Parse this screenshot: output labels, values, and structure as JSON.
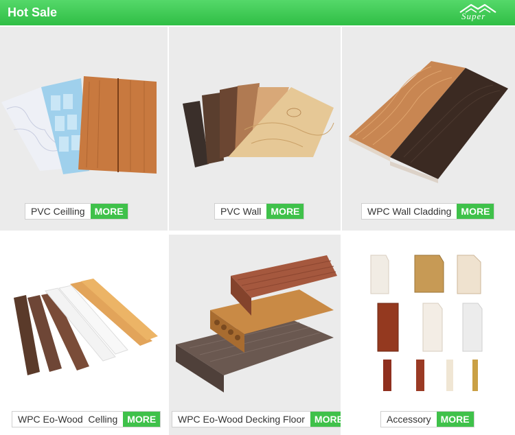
{
  "header": {
    "title": "Hot Sale",
    "logo_text": "Super",
    "bar_color": "#3fc14a"
  },
  "tiles": [
    {
      "label": "PVC Ceilling",
      "more": "MORE"
    },
    {
      "label": "PVC Wall",
      "more": "MORE"
    },
    {
      "label": "WPC Wall Cladding",
      "more": "MORE"
    },
    {
      "label": "WPC Eo-Wood  Celling",
      "more": "MORE"
    },
    {
      "label": "WPC Eo-Wood Decking Floor",
      "more": "MORE"
    },
    {
      "label": "Accessory",
      "more": "MORE"
    }
  ],
  "icons": [
    "house-logo-icon"
  ]
}
